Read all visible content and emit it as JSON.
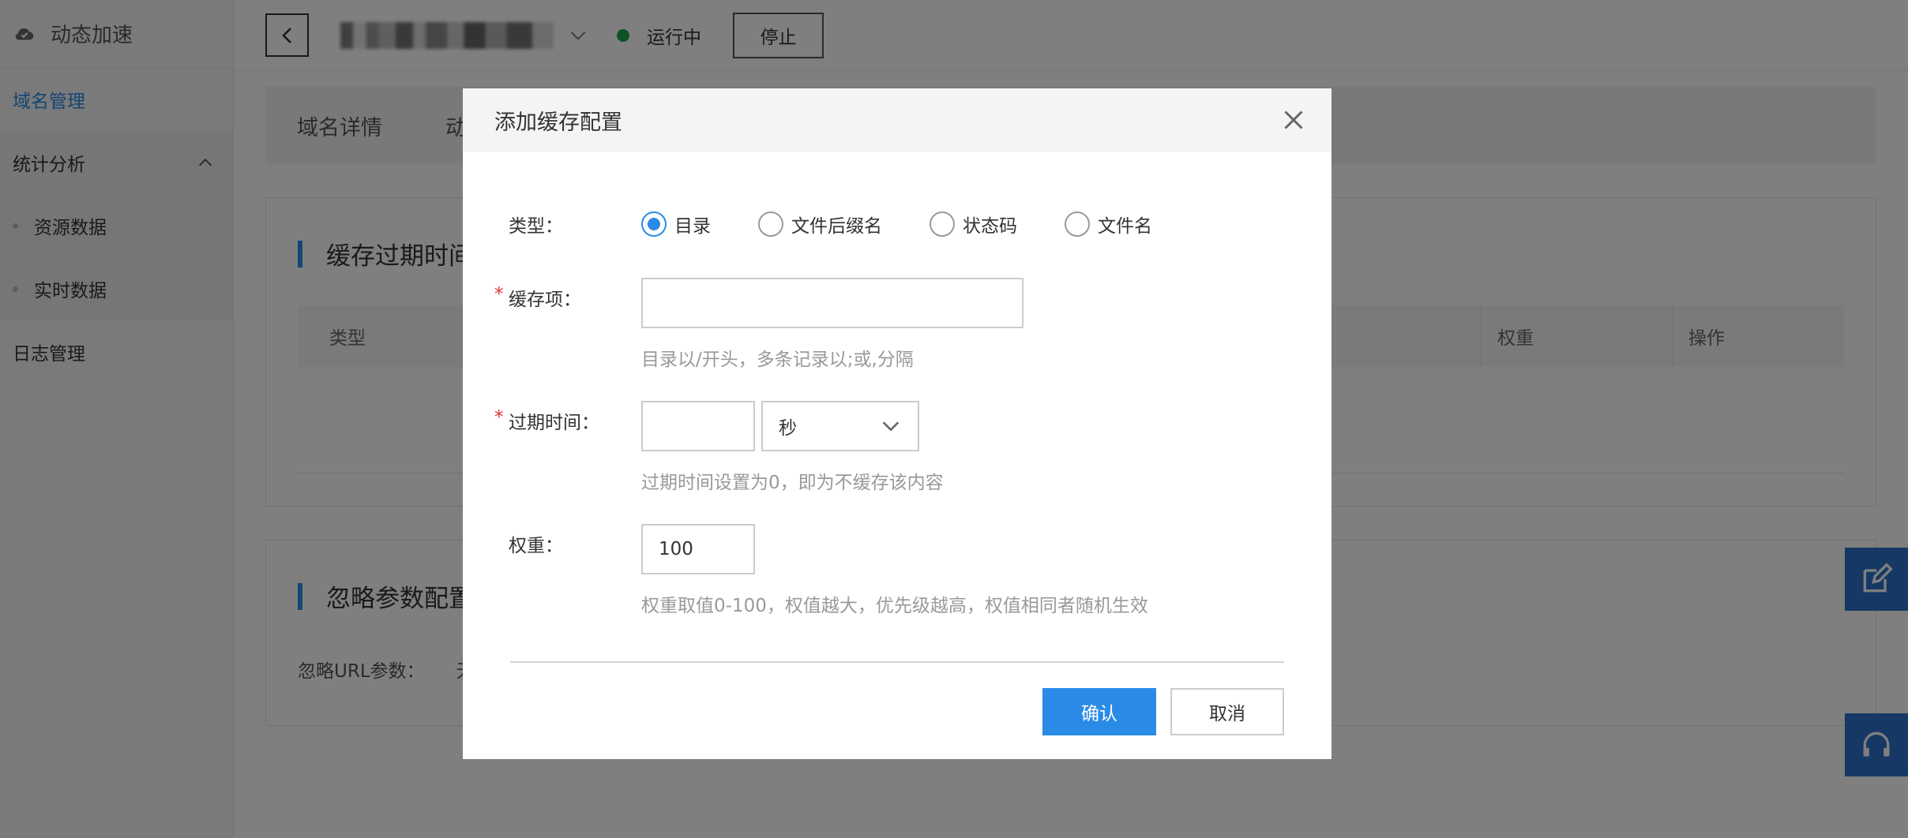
{
  "sidebar": {
    "title": "动态加速",
    "items": [
      {
        "label": "域名管理"
      },
      {
        "label": "统计分析"
      },
      {
        "label": "资源数据"
      },
      {
        "label": "实时数据"
      },
      {
        "label": "日志管理"
      }
    ]
  },
  "topbar": {
    "status": "运行中",
    "stop_label": "停止"
  },
  "tabs": [
    {
      "label": "域名详情"
    },
    {
      "label": "动"
    }
  ],
  "panel_cache": {
    "title": "缓存过期时间",
    "columns": {
      "type": "类型",
      "weight": "权重",
      "op": "操作"
    }
  },
  "panel_ignore": {
    "title": "忽略参数配置",
    "label": "忽略URL参数：",
    "value": "无"
  },
  "modal": {
    "title": "添加缓存配置",
    "type_label": "类型：",
    "type_options": [
      {
        "label": "目录",
        "selected": true
      },
      {
        "label": "文件后缀名",
        "selected": false
      },
      {
        "label": "状态码",
        "selected": false
      },
      {
        "label": "文件名",
        "selected": false
      }
    ],
    "cache_item_label": "缓存项：",
    "cache_item_value": "",
    "cache_item_hint": "目录以/开头，多条记录以;或,分隔",
    "expire_label": "过期时间：",
    "expire_value": "",
    "expire_unit": "秒",
    "expire_hint": "过期时间设置为0，即为不缓存该内容",
    "weight_label": "权重：",
    "weight_value": "100",
    "weight_hint": "权重取值0-100，权值越大，优先级越高，权值相同者随机生效",
    "required_mark": "*",
    "ok_label": "确认",
    "cancel_label": "取消"
  },
  "colors": {
    "accent": "#2a8be6",
    "running": "#1aa34a",
    "required": "#e5322d",
    "float_button": "#2a72c9"
  }
}
